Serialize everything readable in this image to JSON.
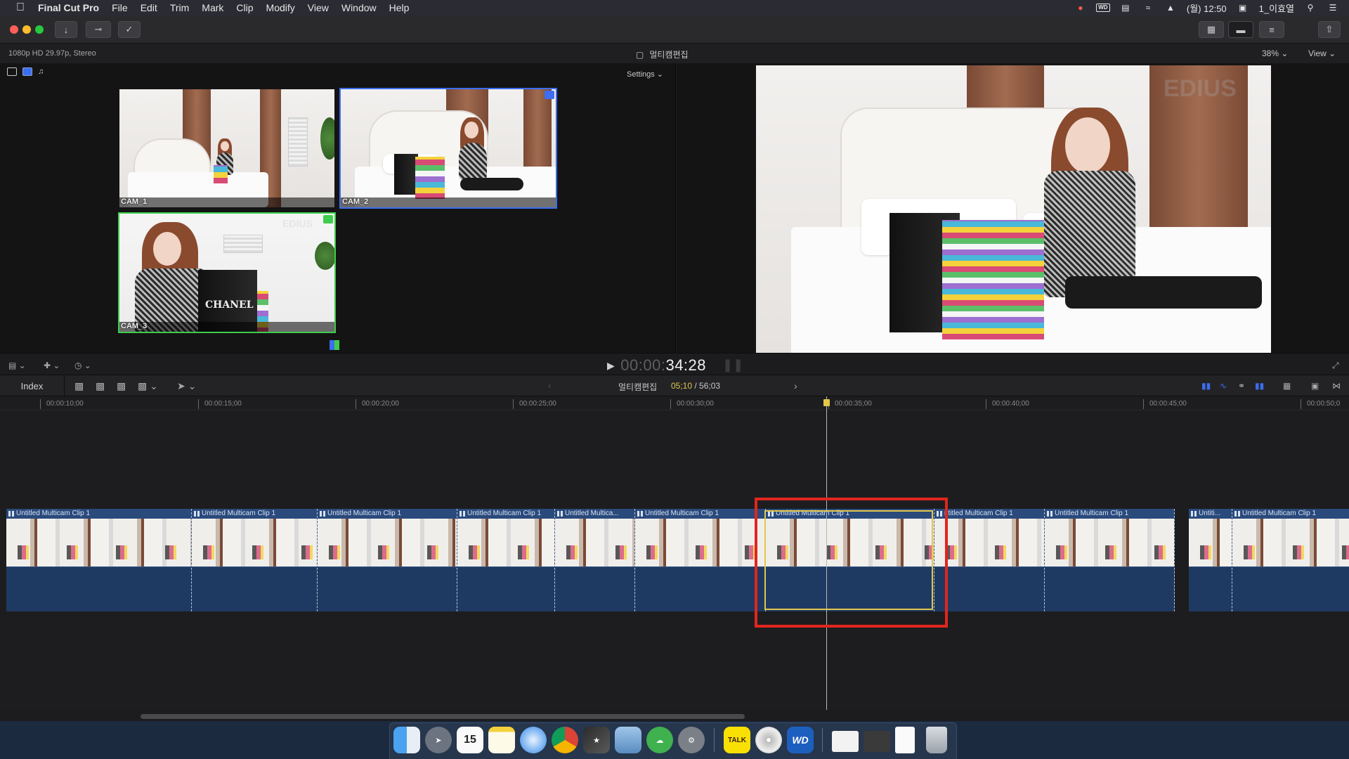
{
  "menubar": {
    "app": "Final Cut Pro",
    "items": [
      "File",
      "Edit",
      "Trim",
      "Mark",
      "Clip",
      "Modify",
      "View",
      "Window",
      "Help"
    ],
    "clock": "(월) 12:50",
    "user": "1_이효열",
    "wd_label": "WD"
  },
  "infobar": {
    "format": "1080p HD 29.97p, Stereo",
    "project": "멀티캠편집",
    "zoom": "38%",
    "view": "View"
  },
  "angle_viewer": {
    "settings": "Settings",
    "angles": [
      {
        "label": "CAM_1"
      },
      {
        "label": "CAM_2"
      },
      {
        "label": "CAM_3"
      }
    ],
    "bag_text": "CHANEL",
    "watermark": "EDIUS"
  },
  "transport": {
    "timecode_dim": "00:00:",
    "timecode_bright": "34:28"
  },
  "timeline_header": {
    "index": "Index",
    "name": "멀티캠편집",
    "selected_duration": "05;10",
    "total_duration": "/ 56;03"
  },
  "ruler": {
    "ticks": [
      "00:00:10;00",
      "00:00:15;00",
      "00:00:20;00",
      "00:00:25;00",
      "00:00:30;00",
      "00:00:35;00",
      "00:00:40;00",
      "00:00:45;00",
      "00:00:50;0"
    ]
  },
  "clips": [
    {
      "title": "Untitled Multicam Clip 1"
    },
    {
      "title": "Untitled Multicam Clip 1"
    },
    {
      "title": "Untitled Multicam Clip 1"
    },
    {
      "title": "Untitled Multicam Clip 1"
    },
    {
      "title": "Untitled Multica..."
    },
    {
      "title": "Untitled Multicam Clip 1"
    },
    {
      "title": "Untitled Multicam Clip 1"
    },
    {
      "title": "ntitled Multicam Clip 1"
    },
    {
      "title": "Untitled Multicam Clip 1"
    },
    {
      "title": "Untiti..."
    },
    {
      "title": "Untitled Multicam Clip 1"
    }
  ],
  "dock": {
    "calendar_day": "15",
    "talk_label": "TALK",
    "wd_label": "WD"
  },
  "colors": {
    "accent_yellow": "#e3c74a",
    "highlight_red": "#e0261e",
    "active_video": "#3d6df0",
    "active_audio": "#3fcc4c"
  }
}
